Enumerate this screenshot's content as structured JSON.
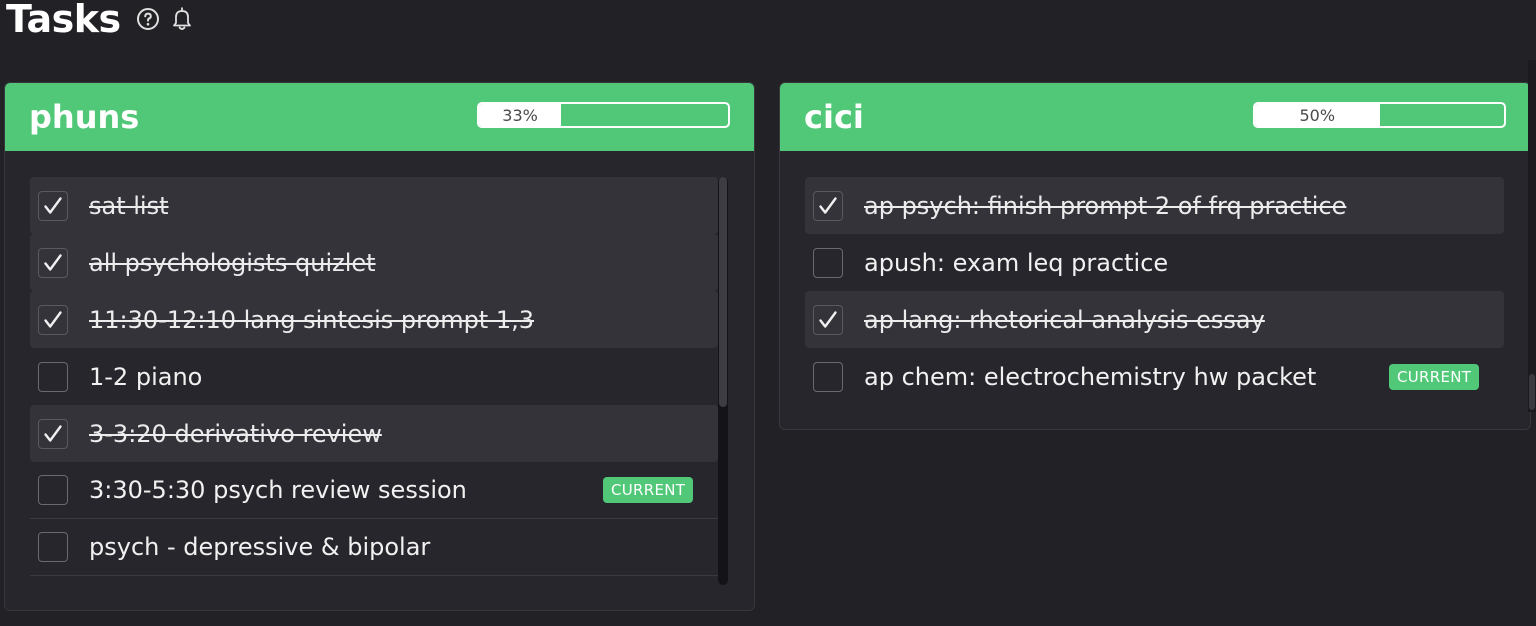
{
  "page": {
    "title": "Tasks",
    "icons": [
      "help-circle-icon",
      "bell-icon"
    ]
  },
  "colors": {
    "accent": "#50c878",
    "background": "#222126",
    "panel": "#27262c",
    "done_row": "#34333a"
  },
  "panels": [
    {
      "name": "phuns",
      "progress": {
        "label": "33%",
        "value": 0.33
      },
      "tasks": [
        {
          "text": "sat list",
          "done": true
        },
        {
          "text": "all psychologists quizlet",
          "done": true
        },
        {
          "text": "11:30-12:10 lang sintesis prompt 1,3",
          "done": true
        },
        {
          "text": "1-2 piano",
          "done": false
        },
        {
          "text": "3-3:20 derivativo review",
          "done": true
        },
        {
          "text": "3:30-5:30 psych review session",
          "done": false,
          "badge": "CURRENT"
        },
        {
          "text": "psych - depressive & bipolar",
          "done": false
        }
      ]
    },
    {
      "name": "cici",
      "progress": {
        "label": "50%",
        "value": 0.5
      },
      "tasks": [
        {
          "text": "ap psych: finish prompt 2 of frq practice",
          "done": true
        },
        {
          "text": "apush: exam leq practice",
          "done": false
        },
        {
          "text": "ap lang: rhetorical analysis essay",
          "done": true
        },
        {
          "text": "ap chem: electrochemistry hw packet",
          "done": false,
          "badge": "CURRENT"
        }
      ]
    }
  ]
}
